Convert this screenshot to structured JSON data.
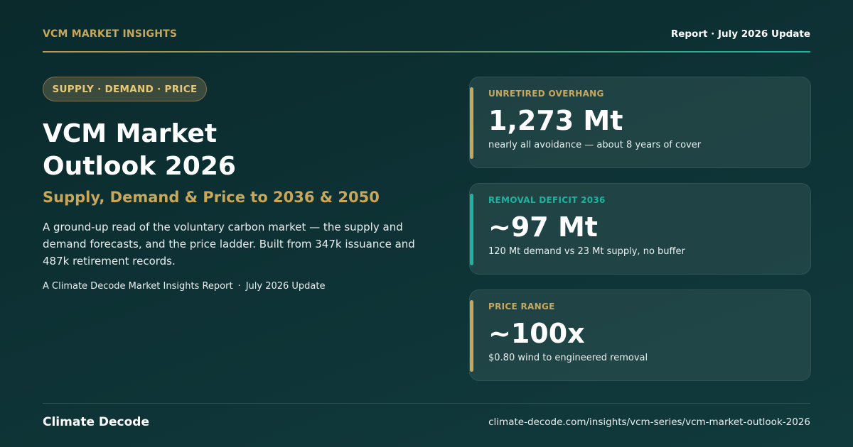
{
  "header": {
    "brand": "VCM MARKET INSIGHTS",
    "report": "Report · July 2026 Update"
  },
  "hero": {
    "pill": "SUPPLY · DEMAND · PRICE",
    "title_line1": "VCM Market",
    "title_line2": "Outlook 2026",
    "subtitle": "Supply, Demand & Price to 2036 & 2050",
    "description": "A ground-up read of the voluntary carbon market — the supply and demand forecasts, and the price ladder. Built from 347k issuance and 487k retirement records.",
    "byline_left": "A Climate Decode Market Insights Report",
    "byline_sep": "·",
    "byline_right": "July 2026 Update"
  },
  "stats": [
    {
      "label": "UNRETIRED OVERHANG",
      "value": "1,273 Mt",
      "note": "nearly all avoidance — about 8 years of cover",
      "accent_color": "#c8a75a",
      "label_color": "#c8a75a"
    },
    {
      "label": "REMOVAL DEFICIT 2036",
      "value": "~97 Mt",
      "note": "120 Mt demand vs 23 Mt supply, no buffer",
      "accent_color": "#1db3a0",
      "label_color": "#1db3a0"
    },
    {
      "label": "PRICE RANGE",
      "value": "~100x",
      "note": "$0.80 wind to engineered removal",
      "accent_color": "#c8a75a",
      "label_color": "#c8a75a"
    }
  ],
  "footer": {
    "brand": "Climate Decode",
    "url": "climate-decode.com/insights/vcm-series/vcm-market-outlook-2026"
  },
  "colors": {
    "gold": "#c8a75a",
    "teal": "#1db3a0",
    "background": "#0e3336"
  }
}
